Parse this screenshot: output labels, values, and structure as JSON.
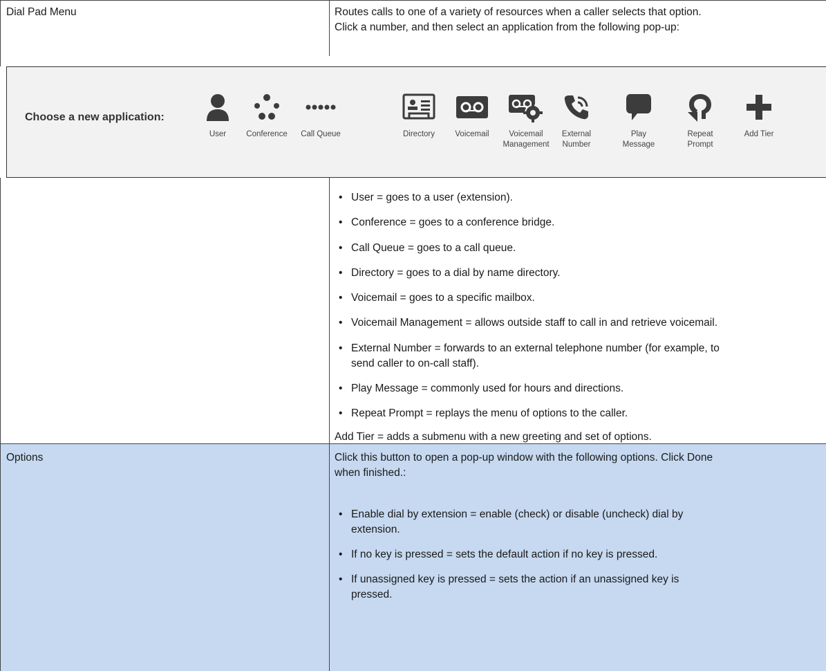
{
  "top_row": {
    "label": "Dial Pad Menu",
    "desc_line1": "Routes calls to one of a variety of resources when a caller selects that option.",
    "desc_line2": "Click a number, and then select an application from the following pop-up:"
  },
  "chooser": {
    "title": "Choose a new application:",
    "apps": [
      {
        "icon": "user-icon",
        "line1": "User",
        "line2": ""
      },
      {
        "icon": "conference-icon",
        "line1": "Conference",
        "line2": ""
      },
      {
        "icon": "call-queue-icon",
        "line1": "Call Queue",
        "line2": ""
      },
      {
        "icon": "directory-icon",
        "line1": "Directory",
        "line2": ""
      },
      {
        "icon": "voicemail-icon",
        "line1": "Voicemail",
        "line2": ""
      },
      {
        "icon": "voicemail-management-icon",
        "line1": "Voicemail",
        "line2": "Management"
      },
      {
        "icon": "external-number-icon",
        "line1": "External",
        "line2": "Number"
      },
      {
        "icon": "play-message-icon",
        "line1": "Play",
        "line2": "Message"
      },
      {
        "icon": "repeat-prompt-icon",
        "line1": "Repeat",
        "line2": "Prompt"
      },
      {
        "icon": "add-tier-icon",
        "line1": "Add Tier",
        "line2": ""
      }
    ]
  },
  "bullets": [
    "User = goes to a user (extension).",
    "Conference = goes to a conference bridge.",
    "Call Queue = goes to a call queue.",
    "Directory = goes to a dial by name directory.",
    "Voicemail = goes to a specific mailbox.",
    "Voicemail Management = allows outside staff to call in and retrieve voicemail.",
    "External Number = forwards to an external telephone number (for example, to",
    "send caller to on-call staff).",
    "Play Message = commonly used for hours and directions.",
    "Repeat Prompt = replays the menu of options to the caller."
  ],
  "add_tier_note": "Add Tier = adds a submenu with a new greeting and set of options.",
  "options_row": {
    "label": "Options",
    "desc_line1": "Click this button to open a pop-up window with the following options. Click Done",
    "desc_line2": "when finished.:",
    "bullets": [
      "Enable dial by extension = enable (check) or disable (uncheck) dial by",
      "extension.",
      "If no key is pressed = sets the default action if no key is pressed.",
      "If unassigned key is pressed = sets the action if an unassigned key is",
      "pressed."
    ]
  },
  "bullet_char": "•"
}
